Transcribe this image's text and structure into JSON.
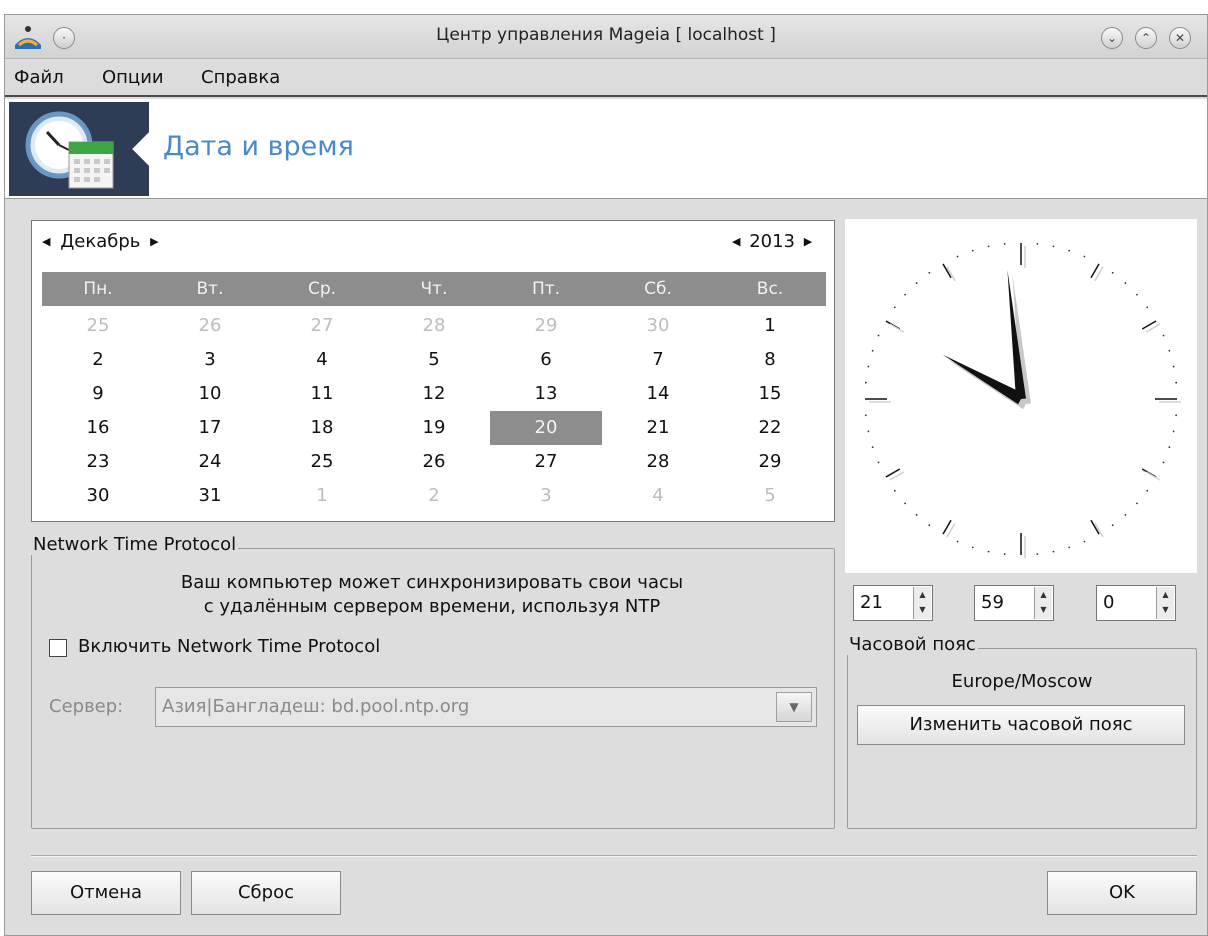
{
  "window": {
    "title": "Центр управления Mageia  [ localhost ]",
    "controls": [
      "minimize",
      "maximize",
      "close"
    ]
  },
  "menu": [
    "Файл",
    "Опции",
    "Справка"
  ],
  "header": {
    "title": "Дата и время",
    "icon": "clock-calendar-icon"
  },
  "calendar": {
    "month": "Декабрь",
    "year": "2013",
    "weekdays": [
      "Пн.",
      "Вт.",
      "Ср.",
      "Чт.",
      "Пт.",
      "Сб.",
      "Вс."
    ],
    "weeks": [
      [
        "25",
        "26",
        "27",
        "28",
        "29",
        "30",
        "1"
      ],
      [
        "2",
        "3",
        "4",
        "5",
        "6",
        "7",
        "8"
      ],
      [
        "9",
        "10",
        "11",
        "12",
        "13",
        "14",
        "15"
      ],
      [
        "16",
        "17",
        "18",
        "19",
        "20",
        "21",
        "22"
      ],
      [
        "23",
        "24",
        "25",
        "26",
        "27",
        "28",
        "29"
      ],
      [
        "30",
        "31",
        "1",
        "2",
        "3",
        "4",
        "5"
      ]
    ],
    "selected_day": "20"
  },
  "ntp": {
    "group_title": "Network Time Protocol",
    "description_line1": "Ваш компьютер может синхронизировать свои часы",
    "description_line2": "с удалённым сервером времени, используя NTP",
    "enable_label": "Включить Network Time Protocol",
    "enabled": false,
    "server_label": "Сервер:",
    "server_value": "Азия|Бангладеш: bd.pool.ntp.org"
  },
  "time": {
    "hours": "21",
    "minutes": "59",
    "seconds": "0"
  },
  "timezone": {
    "group_title": "Часовой пояс",
    "value": "Europe/Moscow",
    "change_button": "Изменить часовой пояс"
  },
  "buttons": {
    "cancel": "Отмена",
    "reset": "Сброс",
    "ok": "OK"
  },
  "colors": {
    "accent": "#4a89c8",
    "calendar_header": "#8d8d8d",
    "banner_icon_bg": "#2e3c55"
  }
}
